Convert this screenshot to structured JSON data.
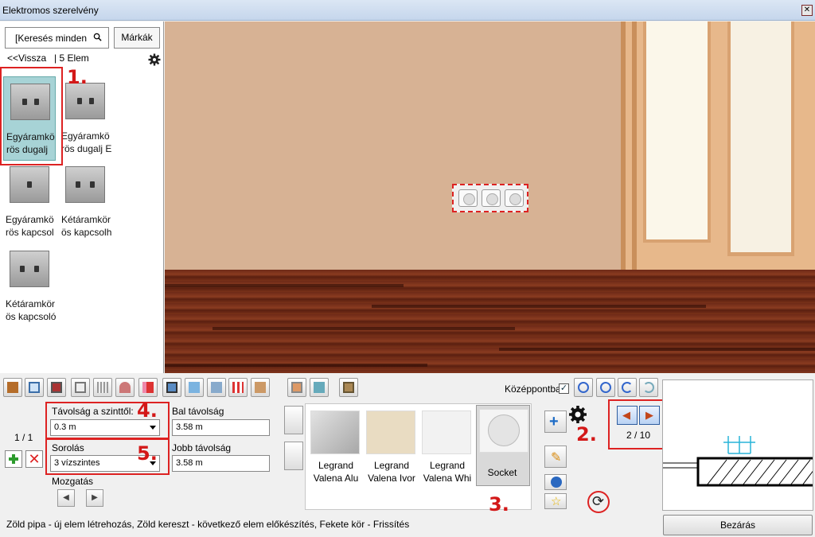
{
  "window": {
    "title": "Elektromos szerelvény",
    "close_glyph": "✕"
  },
  "sidebar": {
    "search_placeholder": "[Keresés minden",
    "brands_label": "Márkák",
    "back_label": "<<Vissza",
    "count_label": "| 5 Elem",
    "items": [
      {
        "label_line1": "Egyáramkö",
        "label_line2": "rös dugalj",
        "selected": true
      },
      {
        "label_line1": "Egyáramkö",
        "label_line2": "rös dugalj E",
        "selected": false
      },
      {
        "label_line1": "Egyáramkö",
        "label_line2": "rös kapcsol",
        "selected": false
      },
      {
        "label_line1": "Kétáramkör",
        "label_line2": "ös kapcsolh",
        "selected": false
      },
      {
        "label_line1": "Kétáramkör",
        "label_line2": "ös kapcsoló",
        "selected": false
      }
    ]
  },
  "steps": {
    "s1": "1.",
    "s2": "2.",
    "s3": "3.",
    "s4": "4.",
    "s5": "5."
  },
  "toolbar": {
    "center_label": "Középpontba",
    "center_checked": "✓",
    "icons": [
      "door-icon",
      "window-icon",
      "room-icon",
      "cabinet-icon",
      "radiator-icon",
      "lamp-icon",
      "socket-icon",
      "picture-icon",
      "floor-icon",
      "wall-icon",
      "awning-icon",
      "brick-icon",
      "wall-tile-icon",
      "floor-tile-icon",
      "wardrobe-icon",
      "zoom-in-icon",
      "zoom-out-icon",
      "undo-icon",
      "redo-icon"
    ]
  },
  "props": {
    "pager": "1 / 1",
    "distance_from_level_label": "Távolság a szinttől:",
    "distance_from_level_value": "0.3 m",
    "left_distance_label": "Bal távolság",
    "left_distance_value": "3.58 m",
    "arrangement_label": "Sorolás",
    "arrangement_value": "3 vízszintes",
    "right_distance_label": "Jobb távolság",
    "right_distance_value": "3.58 m",
    "move_label": "Mozgatás"
  },
  "gallery": {
    "items": [
      {
        "line1": "Legrand",
        "line2": "Valena Alu",
        "color": "#c4c4c4"
      },
      {
        "line1": "Legrand",
        "line2": "Valena Ivor",
        "color": "#e9dcc2"
      },
      {
        "line1": "Legrand",
        "line2": "Valena Whi",
        "color": "#f2f2f2"
      },
      {
        "line1": "Socket",
        "line2": "",
        "color": "#efefef"
      }
    ]
  },
  "nav": {
    "page": "2 / 10"
  },
  "status_text": "Zöld pipa - új elem létrehozás, Zöld kereszt - következő elem előkészítés, Fekete kör - Frissítés",
  "close_button": "Bezárás",
  "colors": {
    "accent_red": "#d22222",
    "selected_tile": "#a7d3d6",
    "wall": "#d7b294",
    "floor": "#7a3219"
  }
}
